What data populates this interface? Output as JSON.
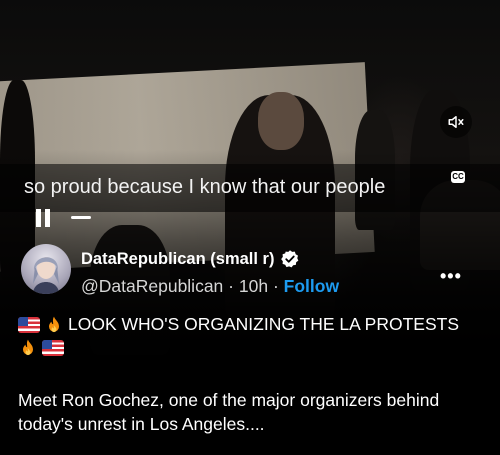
{
  "video": {
    "caption": "so proud because I know that our people",
    "cc_label": "CC"
  },
  "post": {
    "author_name": "DataRepublican (small r)",
    "handle": "@DataRepublican",
    "separator": "·",
    "time": "10h",
    "follow_label": "Follow",
    "more_label": "•••",
    "headline": "LOOK WHO'S ORGANIZING THE LA PROTESTS",
    "body_line1": "Meet Ron Gochez, one of the major organizers behind",
    "body_line2": "today's unrest in Los Angeles...."
  },
  "icons": {
    "mute": "speaker-muted-icon",
    "cc": "closed-captions-icon",
    "pause": "pause-icon",
    "verified": "verified-badge-icon",
    "more": "more-options-icon",
    "flag": "us-flag-emoji",
    "fire": "fire-emoji"
  },
  "colors": {
    "follow": "#1d9bf0",
    "background": "#000000"
  }
}
